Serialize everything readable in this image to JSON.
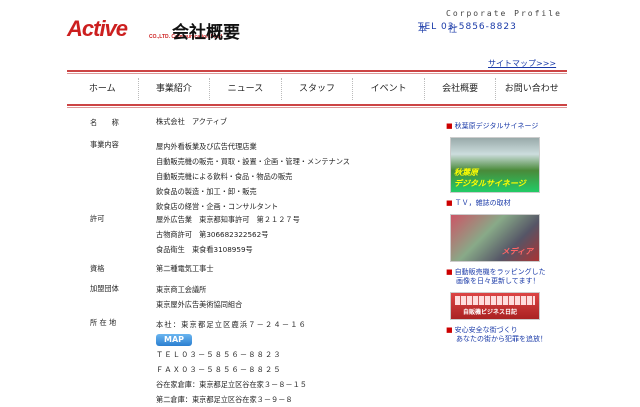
{
  "header": {
    "logo_text": "Active",
    "logo_sub": "CO.,LTD. Communication Field",
    "page_title": "会社概要",
    "corporate_profile": "Corporate Profile",
    "hq_label": "本　　社",
    "hq_phone": "TEL 03-5856-8823",
    "sitemap": "サイトマップ>>>"
  },
  "nav": {
    "items": [
      "ホーム",
      "事業紹介",
      "ニュース",
      "スタッフ",
      "イベント",
      "会社概要",
      "お問い合わせ"
    ]
  },
  "profile": {
    "name_label": "名　　称",
    "name_value": "株式会社　アクティブ",
    "business_label": "事業内容",
    "business_items": [
      "屋内外看板業及び広告代理店業",
      "自動販売機の販売・買取・設置・企画・管理・メンテナンス",
      "自動販売機による飲料・食品・物品の販売",
      "飲食品の製造・加工・卸・販売",
      "飲食店の経営・企画・コンサルタント"
    ],
    "license_label": "許可",
    "license_items": [
      "屋外広告業　東京都知事許可　第２１２７号",
      "古物商許可　第306682322562号",
      "食品衛生　東食看3108959号"
    ],
    "qualification_label": "資格",
    "qualification_value": "第二種電気工事士",
    "membership_label": "加盟団体",
    "membership_items": [
      "東京商工会議所",
      "東京屋外広告美術協同組合"
    ],
    "address_label": "所 在 地",
    "address_main": "本社：東京都足立区鹿浜７－２４－１６",
    "map_button": "MAP",
    "tel": "ＴＥＬ０３－５８５６－８８２３",
    "fax": "ＦＡＸ０３－５８５６－８８２５",
    "office1": "谷在家倉庫：東京都足立区谷在家３－８－１５",
    "office2": "第二倉庫：東京都足立区谷在家３－９－８"
  },
  "sidebar": {
    "link1": "秋葉原デジタルサイネージ",
    "banner1_cap1": "秋葉原",
    "banner1_cap2": "デジタルサイネージ",
    "link2": "ＴＶ，雑誌の取材",
    "banner2_cap": "メディア",
    "link3a": "自動販売機をラッピングした",
    "link3b": "画像を日々更新してます！",
    "banner3_cap": "自販機ビジネス日記",
    "link4a": "安心安全な街づくり",
    "link4b": "あなたの街から犯罪を追放！"
  }
}
